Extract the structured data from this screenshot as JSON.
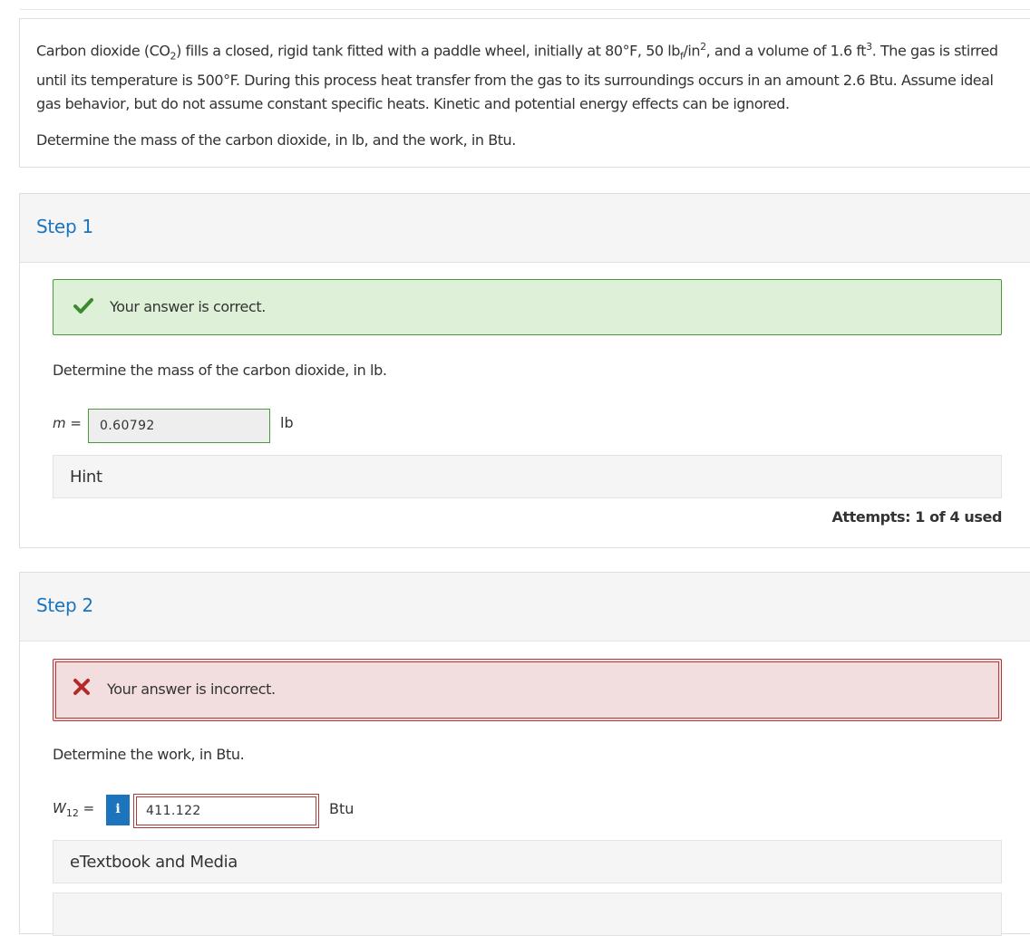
{
  "question": {
    "text_parts": {
      "p1": "Carbon dioxide (CO",
      "sub1": "2",
      "p2": ") fills a closed, rigid tank fitted with a paddle wheel, initially at 80°F, 50 lb",
      "sub2": "f",
      "p3": "/in",
      "sup1": "2",
      "p4": ", and a volume of 1.6 ft",
      "sup2": "3",
      "p5": ". The gas is stirred until its temperature is 500°F. During this process heat transfer from the gas to its surroundings occurs in an amount 2.6 Btu. Assume ideal gas behavior, but do not assume constant specific heats. Kinetic and potential energy effects can be ignored."
    },
    "prompt": "Determine the mass of the carbon dioxide, in lb, and the work, in Btu."
  },
  "steps": [
    {
      "title": "Step 1",
      "feedback": {
        "status": "correct",
        "icon": "check-icon",
        "text": "Your answer is correct."
      },
      "sub_question": "Determine the mass of the carbon dioxide, in lb.",
      "answer": {
        "label": "m =",
        "value": "0.60792",
        "unit": "lb"
      },
      "hint_label": "Hint",
      "attempts": "Attempts: 1 of 4 used"
    },
    {
      "title": "Step 2",
      "feedback": {
        "status": "incorrect",
        "icon": "x-icon",
        "text": "Your answer is incorrect."
      },
      "sub_question": "Determine the work, in Btu.",
      "answer": {
        "label_main": "W",
        "label_sub": "12",
        "label_eq": " =",
        "info_glyph": "i",
        "value": "411.122",
        "unit": "Btu"
      },
      "media_label": "eTextbook and Media"
    }
  ],
  "colors": {
    "accent": "#1c75bc",
    "correct_bg": "#dff0d8",
    "correct_border": "#4a9a3b",
    "incorrect_bg": "#f2dede",
    "incorrect_border": "#b03a3a"
  }
}
